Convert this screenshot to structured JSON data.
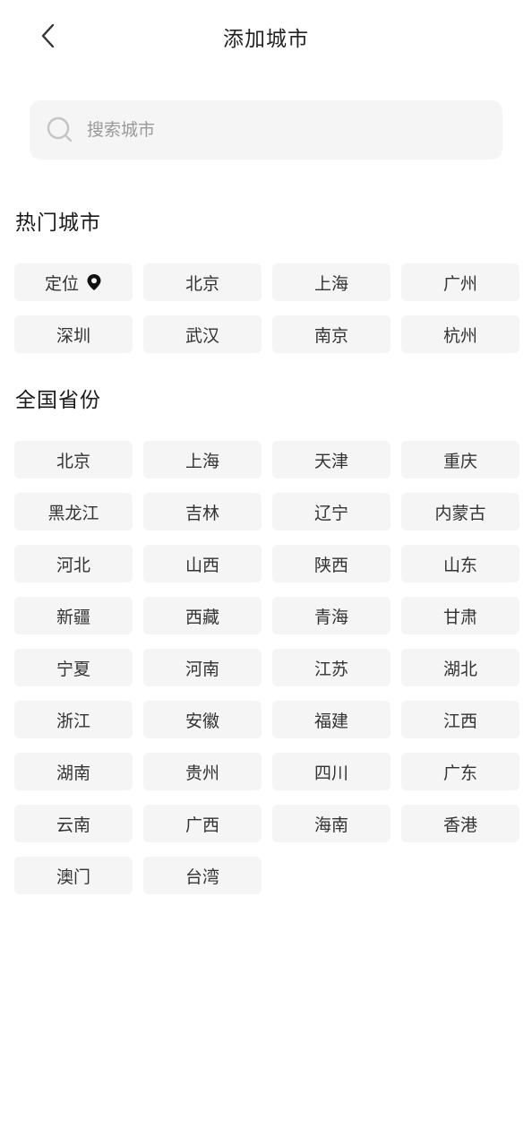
{
  "header": {
    "title": "添加城市",
    "back_icon": "chevron-left-icon"
  },
  "search": {
    "placeholder": "搜索城市",
    "value": "",
    "icon": "search-icon"
  },
  "hot_section": {
    "title": "热门城市",
    "location_label": "定位",
    "location_icon": "map-pin-icon",
    "cities": [
      "北京",
      "上海",
      "广州",
      "深圳",
      "武汉",
      "南京",
      "杭州"
    ]
  },
  "province_section": {
    "title": "全国省份",
    "provinces": [
      "北京",
      "上海",
      "天津",
      "重庆",
      "黑龙江",
      "吉林",
      "辽宁",
      "内蒙古",
      "河北",
      "山西",
      "陕西",
      "山东",
      "新疆",
      "西藏",
      "青海",
      "甘肃",
      "宁夏",
      "河南",
      "江苏",
      "湖北",
      "浙江",
      "安徽",
      "福建",
      "江西",
      "湖南",
      "贵州",
      "四川",
      "广东",
      "云南",
      "广西",
      "海南",
      "香港",
      "澳门",
      "台湾"
    ]
  }
}
